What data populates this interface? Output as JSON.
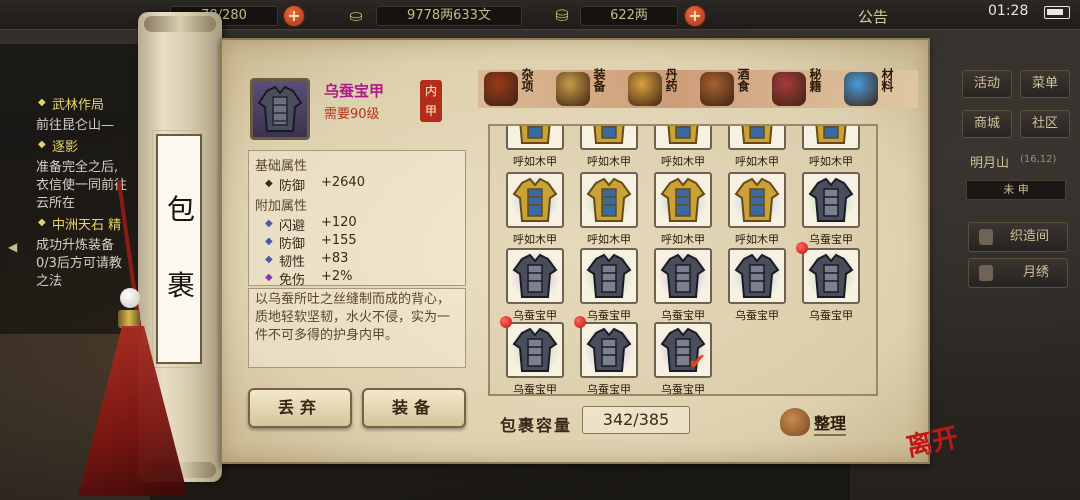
{
  "topbar": {
    "res1_value": "78/280",
    "res2_value": "9778两633文",
    "res3_value": "622两",
    "gonggao": "公告",
    "time": "01:28"
  },
  "quests": [
    {
      "title": "武林作局",
      "lines": [
        "前往昆仑山—"
      ]
    },
    {
      "title": "逐影",
      "lines": [
        "准备完全之后,",
        "衣信使一同前往",
        "云所在"
      ]
    },
    {
      "title": "中洲天石 精",
      "lines": [
        "成功升炼装备",
        "0/3后方可请教",
        "之法"
      ]
    }
  ],
  "side_menu": {
    "huodong": "活动",
    "caidan": "菜单",
    "shangcheng": "商城",
    "shequ": "社区",
    "location": "明月山",
    "coord": "(16,12)",
    "time_tab": "未 申",
    "zhizao": "织造间",
    "yuexiu": "月绣"
  },
  "scroll_title": [
    "包",
    "裹"
  ],
  "item": {
    "name": "乌蚕宝甲",
    "level": "需要90级",
    "type_seal": [
      "内",
      "甲"
    ],
    "icon": "armor-icon"
  },
  "stats": {
    "base_title": "基础属性",
    "base": [
      {
        "name": "防御",
        "value": "+2640"
      }
    ],
    "extra_title": "附加属性",
    "extra": [
      {
        "name": "闪避",
        "value": "+120"
      },
      {
        "name": "防御",
        "value": "+155"
      },
      {
        "name": "韧性",
        "value": "+83"
      },
      {
        "name": "免伤",
        "value": "+2%"
      }
    ]
  },
  "description": "以乌蚕所吐之丝缝制而成的背心，质地轻软坚韧，水火不侵，实为一件不可多得的护身内甲。",
  "buttons": {
    "discard": "丢弃",
    "equip": "装备"
  },
  "tabs": [
    {
      "label": "杂项",
      "icon": "jar-icon"
    },
    {
      "label": "装备",
      "icon": "scroll-weapon-icon"
    },
    {
      "label": "丹药",
      "icon": "pills-icon"
    },
    {
      "label": "酒食",
      "icon": "wine-food-icon"
    },
    {
      "label": "秘籍",
      "icon": "books-icon"
    },
    {
      "label": "材料",
      "icon": "crystal-icon"
    }
  ],
  "inventory": [
    {
      "name": "呼如木甲",
      "kind": "gold",
      "glow": "none"
    },
    {
      "name": "呼如木甲",
      "kind": "gold",
      "glow": "none"
    },
    {
      "name": "呼如木甲",
      "kind": "gold",
      "glow": "none"
    },
    {
      "name": "呼如木甲",
      "kind": "gold",
      "glow": "none"
    },
    {
      "name": "呼如木甲",
      "kind": "gold",
      "glow": "none"
    },
    {
      "name": "呼如木甲",
      "kind": "gold",
      "glow": "blue"
    },
    {
      "name": "呼如木甲",
      "kind": "gold",
      "glow": "green"
    },
    {
      "name": "呼如木甲",
      "kind": "gold",
      "glow": "blue"
    },
    {
      "name": "呼如木甲",
      "kind": "gold",
      "glow": "blue"
    },
    {
      "name": "乌蚕宝甲",
      "kind": "dark",
      "glow": "green"
    },
    {
      "name": "乌蚕宝甲",
      "kind": "dark",
      "glow": "purple"
    },
    {
      "name": "乌蚕宝甲",
      "kind": "dark",
      "glow": "green"
    },
    {
      "name": "乌蚕宝甲",
      "kind": "dark",
      "glow": "purple"
    },
    {
      "name": "乌蚕宝甲",
      "kind": "dark",
      "glow": "blue"
    },
    {
      "name": "乌蚕宝甲",
      "kind": "dark",
      "glow": "green",
      "alert": true
    },
    {
      "name": "乌蚕宝甲",
      "kind": "dark",
      "glow": "green",
      "alert": true
    },
    {
      "name": "乌蚕宝甲",
      "kind": "dark",
      "glow": "purple",
      "alert": true
    },
    {
      "name": "乌蚕宝甲",
      "kind": "dark",
      "glow": "purple",
      "selected": true
    }
  ],
  "capacity": {
    "label": "包裹容量",
    "value": "342/385"
  },
  "sort_label": "整理",
  "leave_label": "离开",
  "colors": {
    "item_name": "#b01888",
    "level_req": "#b83018",
    "seal": "#b42c1a",
    "gold_armor": "#c9a23a",
    "dark_armor": "#4a4e5c"
  }
}
